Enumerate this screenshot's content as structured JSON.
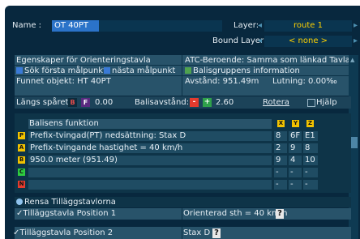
{
  "header": {
    "name_label": "Name :",
    "name_value": "OT 40PT",
    "layer_label": "Layer:",
    "layer_value": "route 1",
    "bound_layer_label": "Bound Layer:",
    "bound_layer_value": "< none >"
  },
  "props": {
    "title": "Egenskaper för Orienteringstavla",
    "atc": "ATC-Beroende:  Samma som länkad Tavla",
    "search_first": "Sök första målpunkt",
    "search_next": "nästa målpunkt",
    "group_info": "Balisgruppens information",
    "found_object": "Funnet objekt: HT 40PT",
    "distance": "Avstånd: 951.49m",
    "gradient": "Lutning: 0.00‰"
  },
  "controls": {
    "along_track_label": "Längs spåret:",
    "b_label": "B",
    "f_label": "F",
    "along_value": "0.00",
    "balise_distance_label": "Balisavstånd:",
    "minus_label": "-",
    "plus_label": "+",
    "balise_value": "2.60",
    "rotate_label": "Rotera",
    "help_label": "Hjälp"
  },
  "function_table": {
    "header": "Balisens funktion",
    "col_headers": [
      "X",
      "Y",
      "Z"
    ],
    "rows": [
      {
        "badge": "P",
        "text": "Prefix-tvingad(PT) nedsättning: Stax D",
        "x": "8",
        "y": "6F",
        "z": "E1"
      },
      {
        "badge": "A",
        "text": "Prefix-tvingande hastighet = 40 km/h",
        "x": "2",
        "y": "9",
        "z": "8"
      },
      {
        "badge": "B",
        "text": "950.0 meter (951.49)",
        "x": "9",
        "y": "4",
        "z": "10"
      },
      {
        "badge": "C",
        "text": "",
        "x": "-",
        "y": "-",
        "z": "-"
      },
      {
        "badge": "N",
        "text": "",
        "x": "-",
        "y": "-",
        "z": "-"
      }
    ]
  },
  "extra_boards": {
    "clear_label": "Rensa Tilläggstavlorna",
    "pos1_label": "Tilläggstavla Position 1",
    "pos1_value": "Orienterad sth = 40 km/h",
    "pos1_help": "?",
    "pos2_label": "Tilläggstavla Position 2",
    "pos2_value": "Stax D",
    "pos2_help": "?"
  },
  "colors": {
    "background": "#08283e",
    "panel": "#28536a",
    "accent_yellow": "#ffd200",
    "badge_p": "#f2c200",
    "badge_a": "#f2c200",
    "badge_b": "#f2c200",
    "badge_c": "#2ecc40",
    "badge_n": "#e33b2e"
  }
}
